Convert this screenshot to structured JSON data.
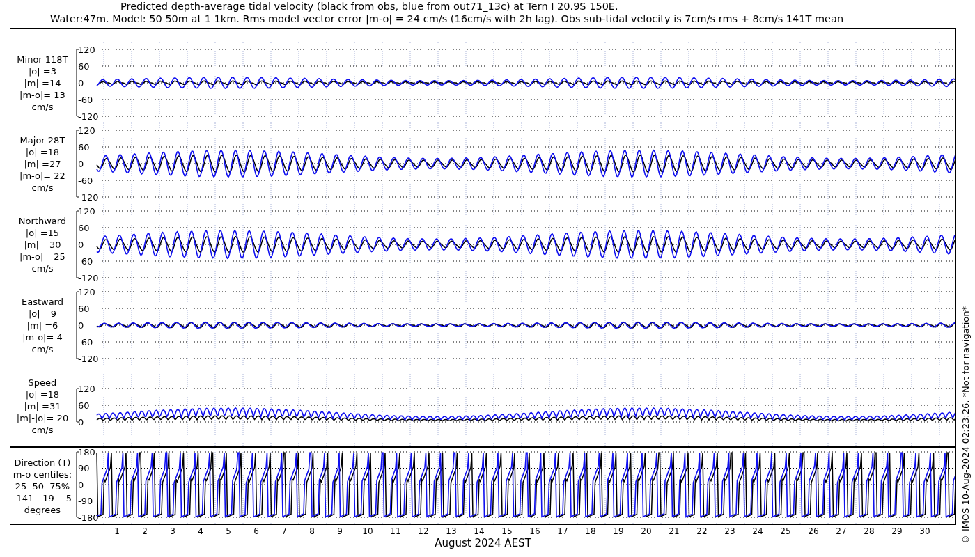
{
  "title": [
    "Predicted depth-average tidal velocity (black from obs, blue from out71_13c) at Tern I 20.9S 150E.",
    "Water:47m. Model: 50 50m at 1 1km. Rms model vector error |m-o| = 24 cm/s (16cm/s with 2h lag). Obs sub-tidal velocity is 7cm/s rms + 8cm/s 141T mean"
  ],
  "panels": [
    {
      "kind": "signed",
      "label": [
        "Minor 118T",
        "|o| =3",
        "|m| =14",
        "|m-o|= 13",
        "cm/s"
      ],
      "yticks": [
        "120",
        "60",
        "0",
        "-60",
        "-120"
      ]
    },
    {
      "kind": "signed",
      "label": [
        "Major 28T",
        "|o| =18",
        "|m| =27",
        "|m-o|= 22",
        "cm/s"
      ],
      "yticks": [
        "120",
        "60",
        "0",
        "-60",
        "-120"
      ]
    },
    {
      "kind": "signed",
      "label": [
        "Northward",
        "|o| =15",
        "|m| =30",
        "|m-o|= 25",
        "cm/s"
      ],
      "yticks": [
        "120",
        "60",
        "0",
        "-60",
        "-120"
      ]
    },
    {
      "kind": "signed",
      "label": [
        "Eastward",
        "|o| =9",
        "|m| =6",
        "|m-o|= 4",
        "cm/s"
      ],
      "yticks": [
        "120",
        "60",
        "0",
        "-60",
        "-120"
      ]
    },
    {
      "kind": "speed",
      "label": [
        "Speed",
        "|o| =18",
        "|m| =31",
        "|m|-|o|= 20",
        "cm/s"
      ],
      "yticks": [
        "120",
        "60",
        "0"
      ]
    },
    {
      "kind": "direction",
      "label": [
        "Direction (T)",
        "m-o centiles:",
        "25  50  75%",
        "-141  -19   -5",
        "degrees"
      ],
      "yticks": [
        "180",
        "90",
        "0",
        "-90",
        "-180"
      ]
    }
  ],
  "x_axis": {
    "ticks": [
      "1",
      "2",
      "3",
      "4",
      "5",
      "6",
      "7",
      "8",
      "9",
      "10",
      "11",
      "12",
      "13",
      "14",
      "15",
      "16",
      "17",
      "18",
      "19",
      "20",
      "21",
      "22",
      "23",
      "24",
      "25",
      "26",
      "27",
      "28",
      "29",
      "30"
    ],
    "label": "August 2024 AEST"
  },
  "footer": "© IMOS 10-Aug-2024 02:23:26. *Not for navigation*"
}
